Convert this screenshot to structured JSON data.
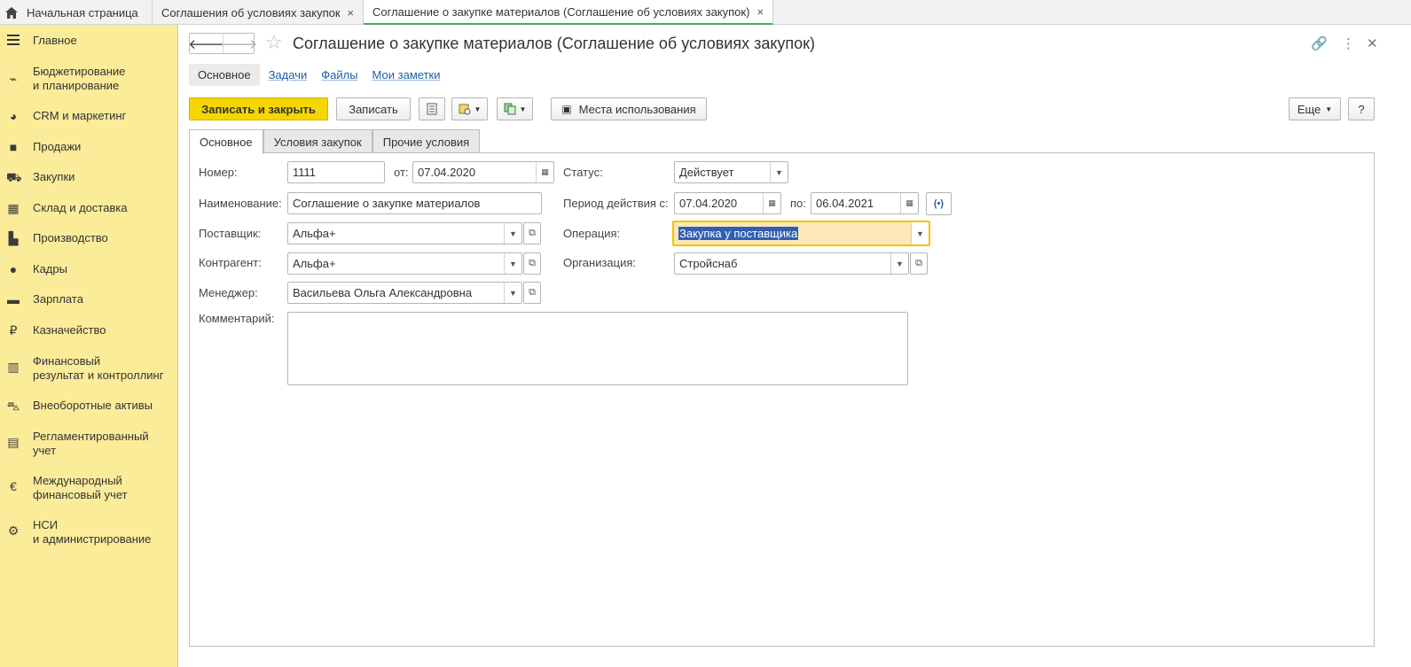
{
  "top_tabs": [
    {
      "label": "Начальная страница"
    },
    {
      "label": "Соглашения об условиях закупок",
      "close": "×"
    },
    {
      "label": "Соглашение о закупке материалов (Соглашение об условиях закупок)",
      "close": "×"
    }
  ],
  "sidebar": {
    "items": [
      {
        "label": "Главное",
        "icon": "menu-icon"
      },
      {
        "label": "Бюджетирование\nи планирование",
        "icon": "budget-icon"
      },
      {
        "label": "CRM и маркетинг",
        "icon": "pie-icon"
      },
      {
        "label": "Продажи",
        "icon": "bag-icon"
      },
      {
        "label": "Закупки",
        "icon": "cart-icon"
      },
      {
        "label": "Склад и доставка",
        "icon": "warehouse-icon"
      },
      {
        "label": "Производство",
        "icon": "factory-icon"
      },
      {
        "label": "Кадры",
        "icon": "person-icon"
      },
      {
        "label": "Зарплата",
        "icon": "wallet-icon"
      },
      {
        "label": "Казначейство",
        "icon": "ruble-icon"
      },
      {
        "label": "Финансовый\nрезультат и контроллинг",
        "icon": "chart-icon"
      },
      {
        "label": "Внеоборотные активы",
        "icon": "truck-icon"
      },
      {
        "label": "Регламентированный\nучет",
        "icon": "calculator-icon"
      },
      {
        "label": "Международный\nфинансовый учет",
        "icon": "euro-icon"
      },
      {
        "label": "НСИ\nи администрирование",
        "icon": "gear-icon"
      }
    ]
  },
  "header": {
    "title": "Соглашение о закупке материалов (Соглашение об условиях закупок)"
  },
  "subtabs": [
    "Основное",
    "Задачи",
    "Файлы",
    "Мои заметки"
  ],
  "toolbar": {
    "save_close": "Записать и закрыть",
    "save": "Записать",
    "usage": "Места использования",
    "more": "Еще",
    "help": "?"
  },
  "form_tabs": [
    "Основное",
    "Условия закупок",
    "Прочие условия"
  ],
  "form": {
    "number_label": "Номер:",
    "number_value": "1111",
    "from_label": "от:",
    "from_value": "07.04.2020",
    "status_label": "Статус:",
    "status_value": "Действует",
    "name_label": "Наименование:",
    "name_value": "Соглашение о закупке материалов",
    "period_label": "Период действия с:",
    "period_from": "07.04.2020",
    "period_to_label": "по:",
    "period_to": "06.04.2021",
    "supplier_label": "Поставщик:",
    "supplier_value": "Альфа+",
    "operation_label": "Операция:",
    "operation_value": "Закупка у поставщика",
    "counterparty_label": "Контрагент:",
    "counterparty_value": "Альфа+",
    "org_label": "Организация:",
    "org_value": "Стройснаб",
    "manager_label": "Менеджер:",
    "manager_value": "Васильева Ольга Александровна",
    "comment_label": "Комментарий:",
    "comment_value": ""
  }
}
